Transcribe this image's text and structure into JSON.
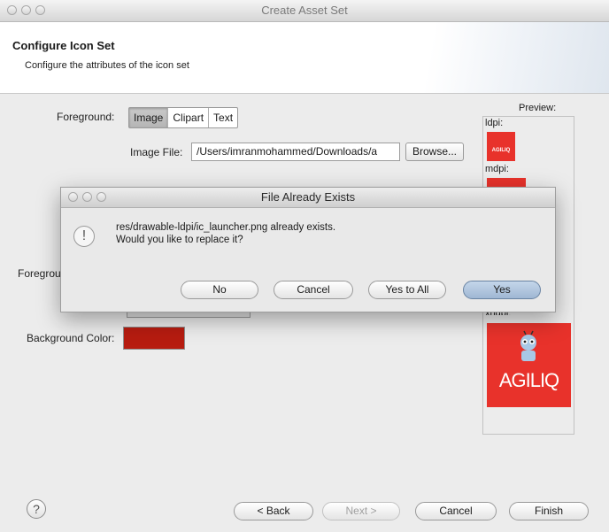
{
  "window": {
    "title": "Create Asset Set"
  },
  "header": {
    "title": "Configure Icon Set",
    "subtitle": "Configure the attributes of the icon set"
  },
  "form": {
    "foreground_label": "Foreground:",
    "foreground_tabs": [
      "Image",
      "Clipart",
      "Text"
    ],
    "foreground_selected": "Image",
    "image_file_label": "Image File:",
    "image_file_value": "/Users/imranmohammed/Downloads/a",
    "browse_label": "Browse...",
    "foreground2_label_visible": "Foregrou",
    "background_color_label": "Background Color:",
    "background_color": "#b71c10"
  },
  "preview": {
    "title": "Preview:",
    "items": [
      {
        "label": "ldpi:",
        "icon_text": "AGILIQ"
      },
      {
        "label": "mdpi:",
        "icon_text": "AGILIQ"
      },
      {
        "label": "xhdpi:",
        "icon_text": "AGILIQ"
      }
    ],
    "icon_color": "#e8322b"
  },
  "dialog": {
    "title": "File Already Exists",
    "icon": "warning-icon",
    "message_line1": "res/drawable-ldpi/ic_launcher.png already exists.",
    "message_line2": "Would you like to replace it?",
    "buttons": {
      "no": "No",
      "cancel": "Cancel",
      "yes_to_all": "Yes to All",
      "yes": "Yes"
    }
  },
  "footer": {
    "help_icon": "?",
    "buttons": {
      "back": "< Back",
      "next": "Next >",
      "cancel": "Cancel",
      "finish": "Finish"
    }
  }
}
